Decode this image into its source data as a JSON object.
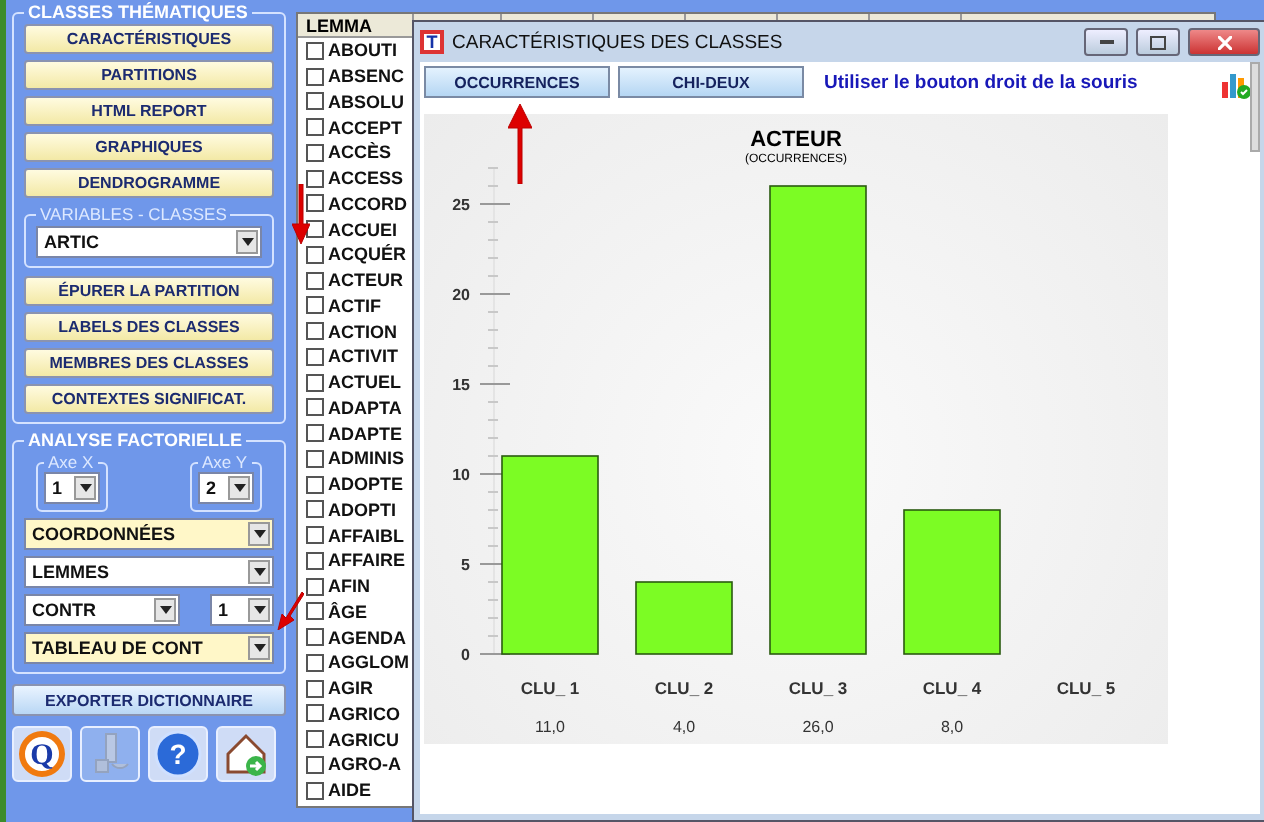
{
  "left_panel": {
    "thematic_group": {
      "legend": "CLASSES THÉMATIQUES",
      "buttons": [
        "CARACTÉRISTIQUES",
        "PARTITIONS",
        "HTML REPORT",
        "GRAPHIQUES",
        "DENDROGRAMME"
      ],
      "variables": {
        "legend": "VARIABLES - CLASSES",
        "value": "ARTIC"
      },
      "buttons_2": [
        "ÉPURER LA PARTITION",
        "LABELS DES CLASSES",
        "MEMBRES DES CLASSES",
        "CONTEXTES SIGNIFICAT."
      ]
    },
    "factorial_group": {
      "legend": "ANALYSE FACTORIELLE",
      "axis_x": {
        "legend": "Axe X",
        "value": "1"
      },
      "axis_y": {
        "legend": "Axe Y",
        "value": "2"
      },
      "selects": [
        {
          "value": "COORDONNÉES",
          "highlighted": true
        },
        {
          "value": "LEMMES",
          "highlighted": false
        }
      ],
      "contr": {
        "value": "CONTR"
      },
      "contr_num": {
        "value": "1"
      },
      "table_select": {
        "value": "TABLEAU DE CONT",
        "highlighted": true
      }
    },
    "export_button": "EXPORTER DICTIONNAIRE",
    "tool_buttons": [
      {
        "kind": "logo",
        "label": "Q",
        "disabled": false
      },
      {
        "kind": "lever",
        "disabled": true
      },
      {
        "kind": "help",
        "label": "?",
        "disabled": false
      },
      {
        "kind": "home",
        "disabled": false
      }
    ]
  },
  "lemma_list": {
    "header": "LEMMA",
    "items": [
      {
        "label": "ABOUTI",
        "checked": false
      },
      {
        "label": "ABSENC",
        "checked": false
      },
      {
        "label": "ABSOLU",
        "checked": false
      },
      {
        "label": "ACCEPT",
        "checked": false
      },
      {
        "label": "ACCÈS",
        "checked": false
      },
      {
        "label": "ACCESS",
        "checked": false
      },
      {
        "label": "ACCORD",
        "checked": false
      },
      {
        "label": "ACCUEI",
        "checked": false
      },
      {
        "label": "ACQUÉR",
        "checked": false
      },
      {
        "label": "ACTEUR",
        "checked": false
      },
      {
        "label": "ACTIF",
        "checked": false
      },
      {
        "label": "ACTION",
        "checked": false
      },
      {
        "label": "ACTIVIT",
        "checked": false
      },
      {
        "label": "ACTUEL",
        "checked": false
      },
      {
        "label": "ADAPTA",
        "checked": false
      },
      {
        "label": "ADAPTE",
        "checked": false
      },
      {
        "label": "ADMINIS",
        "checked": false
      },
      {
        "label": "ADOPTE",
        "checked": false
      },
      {
        "label": "ADOPTI",
        "checked": false
      },
      {
        "label": "AFFAIBL",
        "checked": false
      },
      {
        "label": "AFFAIRE",
        "checked": false
      },
      {
        "label": "AFIN",
        "checked": false
      },
      {
        "label": "ÂGE",
        "checked": false
      },
      {
        "label": "AGENDA",
        "checked": false
      },
      {
        "label": "AGGLOM",
        "checked": false
      },
      {
        "label": "AGIR",
        "checked": false
      },
      {
        "label": "AGRICO",
        "checked": false
      },
      {
        "label": "AGRICU",
        "checked": false
      },
      {
        "label": "AGRO-A",
        "checked": false
      },
      {
        "label": "AIDE",
        "checked": false
      }
    ]
  },
  "dialog": {
    "title": "CARACTÉRISTIQUES DES CLASSES",
    "icon_letter": "T",
    "buttons": [
      "OCCURRENCES",
      "CHI-DEUX"
    ],
    "hint": "Utiliser le bouton droit de la souris",
    "chart_data": {
      "type": "bar",
      "title": "ACTEUR",
      "categories": [
        "CLU_ 1",
        "CLU_ 2",
        "CLU_ 3",
        "CLU_ 4",
        "CLU_ 5"
      ],
      "series": [
        {
          "name": "(OCCURRENCES)",
          "color": "#7cfc24",
          "values": [
            11,
            4,
            26,
            8,
            null
          ]
        }
      ],
      "ylim": [
        0,
        27
      ],
      "yticks": [
        0,
        5,
        10,
        15,
        20,
        25
      ],
      "value_labels": [
        "11,0",
        "4,0",
        "26,0",
        "8,0",
        null
      ]
    }
  }
}
